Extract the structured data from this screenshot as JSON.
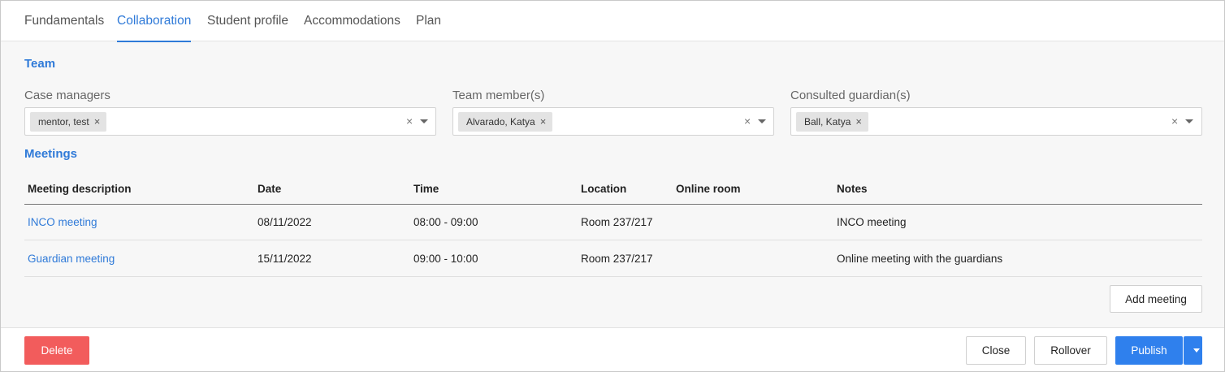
{
  "tabs": [
    {
      "label": "Fundamentals"
    },
    {
      "label": "Collaboration"
    },
    {
      "label": "Student profile"
    },
    {
      "label": "Accommodations"
    },
    {
      "label": "Plan"
    }
  ],
  "team": {
    "title": "Team",
    "case_managers": {
      "label": "Case managers",
      "chips": [
        "mentor, test"
      ]
    },
    "team_members": {
      "label": "Team member(s)",
      "chips": [
        "Alvarado, Katya"
      ]
    },
    "guardians": {
      "label": "Consulted guardian(s)",
      "chips": [
        "Ball, Katya"
      ]
    },
    "chip_remove": "×",
    "clear": "×"
  },
  "meetings": {
    "title": "Meetings",
    "columns": [
      "Meeting description",
      "Date",
      "Time",
      "Location",
      "Online room",
      "Notes"
    ],
    "rows": [
      {
        "description": "INCO meeting",
        "date": "08/11/2022",
        "time": "08:00 - 09:00",
        "location": "Room 237/217",
        "online_room": "",
        "notes": "INCO meeting"
      },
      {
        "description": "Guardian meeting",
        "date": "15/11/2022",
        "time": "09:00 - 10:00",
        "location": "Room 237/217",
        "online_room": "",
        "notes": "Online meeting with the guardians"
      }
    ],
    "add_label": "Add meeting"
  },
  "footer": {
    "delete": "Delete",
    "close": "Close",
    "rollover": "Rollover",
    "publish": "Publish"
  },
  "colors": {
    "accent": "#2f7ad8",
    "primary_button": "#2f80ed",
    "danger_button": "#f25c5c"
  }
}
